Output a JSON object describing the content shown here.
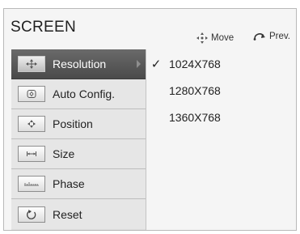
{
  "header": {
    "title": "SCREEN",
    "hint_move": "Move",
    "hint_prev": "Prev.",
    "move_icon": "move-arrows-icon",
    "prev_icon": "return-icon"
  },
  "menu": {
    "items": [
      {
        "label": "Resolution",
        "icon": "resolution-icon",
        "selected": true
      },
      {
        "label": "Auto Config.",
        "icon": "auto-config-icon",
        "selected": false
      },
      {
        "label": "Position",
        "icon": "position-icon",
        "selected": false
      },
      {
        "label": "Size",
        "icon": "size-icon",
        "selected": false
      },
      {
        "label": "Phase",
        "icon": "phase-icon",
        "selected": false
      },
      {
        "label": "Reset",
        "icon": "reset-icon",
        "selected": false
      }
    ]
  },
  "options": {
    "items": [
      {
        "label": "1024X768",
        "checked": true
      },
      {
        "label": "1280X768",
        "checked": false
      },
      {
        "label": "1360X768",
        "checked": false
      }
    ],
    "check_glyph": "✓"
  },
  "colors": {
    "selected_bg": "#5a5a5a",
    "panel_bg": "#dedede",
    "frame_bg": "#f5f5f5"
  }
}
